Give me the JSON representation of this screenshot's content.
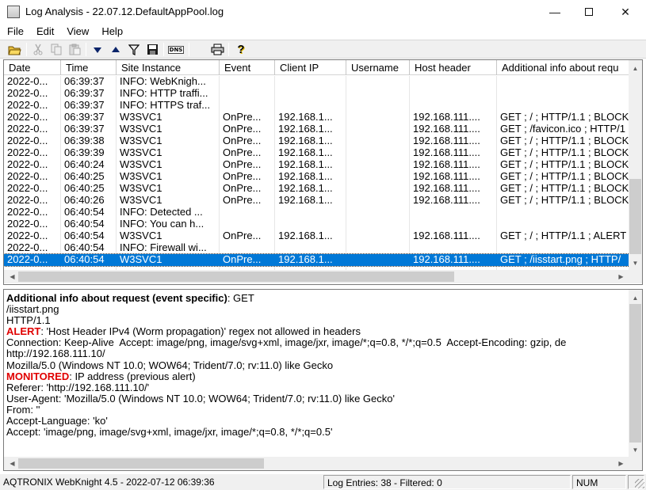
{
  "window": {
    "title": "Log Analysis - 22.07.12.DefaultAppPool.log",
    "minimize": "—",
    "close": "✕"
  },
  "menu": [
    "File",
    "Edit",
    "View",
    "Help"
  ],
  "toolbar": {
    "icons": [
      "open-folder-icon",
      "cut-icon",
      "copy-icon",
      "paste-icon",
      "arrow-down-icon",
      "arrow-up-icon",
      "filter-icon",
      "save-icon",
      "dns-icon",
      "print-icon",
      "help-icon"
    ],
    "dns_label": "DNS",
    "help_label": "?"
  },
  "table": {
    "columns": [
      "Date",
      "Time",
      "Site Instance",
      "Event",
      "Client IP",
      "Username",
      "Host header",
      "Additional info about requ"
    ],
    "rows": [
      [
        "2022-0...",
        "06:39:37",
        "INFO: WebKnigh...",
        "",
        "",
        "",
        "",
        ""
      ],
      [
        "2022-0...",
        "06:39:37",
        "INFO: HTTP traffi...",
        "",
        "",
        "",
        "",
        ""
      ],
      [
        "2022-0...",
        "06:39:37",
        "INFO: HTTPS traf...",
        "",
        "",
        "",
        "",
        ""
      ],
      [
        "2022-0...",
        "06:39:37",
        "W3SVC1",
        "OnPre...",
        "192.168.1...",
        "",
        "192.168.111....",
        "GET ; / ; HTTP/1.1 ; BLOCK"
      ],
      [
        "2022-0...",
        "06:39:37",
        "W3SVC1",
        "OnPre...",
        "192.168.1...",
        "",
        "192.168.111....",
        "GET ; /favicon.ico ; HTTP/1"
      ],
      [
        "2022-0...",
        "06:39:38",
        "W3SVC1",
        "OnPre...",
        "192.168.1...",
        "",
        "192.168.111....",
        "GET ; / ; HTTP/1.1 ; BLOCK"
      ],
      [
        "2022-0...",
        "06:39:39",
        "W3SVC1",
        "OnPre...",
        "192.168.1...",
        "",
        "192.168.111....",
        "GET ; / ; HTTP/1.1 ; BLOCK"
      ],
      [
        "2022-0...",
        "06:40:24",
        "W3SVC1",
        "OnPre...",
        "192.168.1...",
        "",
        "192.168.111....",
        "GET ; / ; HTTP/1.1 ; BLOCK"
      ],
      [
        "2022-0...",
        "06:40:25",
        "W3SVC1",
        "OnPre...",
        "192.168.1...",
        "",
        "192.168.111....",
        "GET ; / ; HTTP/1.1 ; BLOCK"
      ],
      [
        "2022-0...",
        "06:40:25",
        "W3SVC1",
        "OnPre...",
        "192.168.1...",
        "",
        "192.168.111....",
        "GET ; / ; HTTP/1.1 ; BLOCK"
      ],
      [
        "2022-0...",
        "06:40:26",
        "W3SVC1",
        "OnPre...",
        "192.168.1...",
        "",
        "192.168.111....",
        "GET ; / ; HTTP/1.1 ; BLOCK"
      ],
      [
        "2022-0...",
        "06:40:54",
        "INFO: Detected ...",
        "",
        "",
        "",
        "",
        ""
      ],
      [
        "2022-0...",
        "06:40:54",
        "INFO: You can h...",
        "",
        "",
        "",
        "",
        ""
      ],
      [
        "2022-0...",
        "06:40:54",
        "W3SVC1",
        "OnPre...",
        "192.168.1...",
        "",
        "192.168.111....",
        "GET ; / ; HTTP/1.1 ; ALERT"
      ],
      [
        "2022-0...",
        "06:40:54",
        "INFO: Firewall wi...",
        "",
        "",
        "",
        "",
        ""
      ],
      [
        "2022-0...",
        "06:40:54",
        "W3SVC1",
        "OnPre...",
        "192.168.1...",
        "",
        "192.168.111....",
        "GET ; /iisstart.png ; HTTP/"
      ]
    ],
    "selected_row": 15
  },
  "detail": {
    "heading": "Additional info about request (event specific)",
    "heading_value": ": GET",
    "line_path": "/iisstart.png",
    "line_proto": "HTTP/1.1",
    "alert_label": "ALERT",
    "alert_text": ": 'Host Header IPv4 (Worm propagation)' regex not allowed in headers",
    "line_connection": "Connection: Keep-Alive  Accept: image/png, image/svg+xml, image/jxr, image/*;q=0.8, */*;q=0.5  Accept-Encoding: gzip, de",
    "line_http": "http://192.168.111.10/",
    "line_mozilla": "Mozilla/5.0 (Windows NT 10.0; WOW64; Trident/7.0; rv:11.0) like Gecko",
    "monitored_label": "MONITORED",
    "monitored_text": ": IP address (previous alert)",
    "line_referer": "Referer: 'http://192.168.111.10/'",
    "line_useragent": "User-Agent: 'Mozilla/5.0 (Windows NT 10.0; WOW64; Trident/7.0; rv:11.0) like Gecko'",
    "line_from": "From: ''",
    "line_lang": "Accept-Language: 'ko'",
    "line_accept": "Accept: 'image/png, image/svg+xml, image/jxr, image/*;q=0.8, */*;q=0.5'"
  },
  "status": {
    "app": "AQTRONIX WebKnight 4.5 - 2022-07-12 06:39:36",
    "entries": "Log Entries: 38 - Filtered: 0",
    "num": "NUM"
  },
  "colors": {
    "selection": "#0078d7",
    "alert": "#e00000"
  }
}
